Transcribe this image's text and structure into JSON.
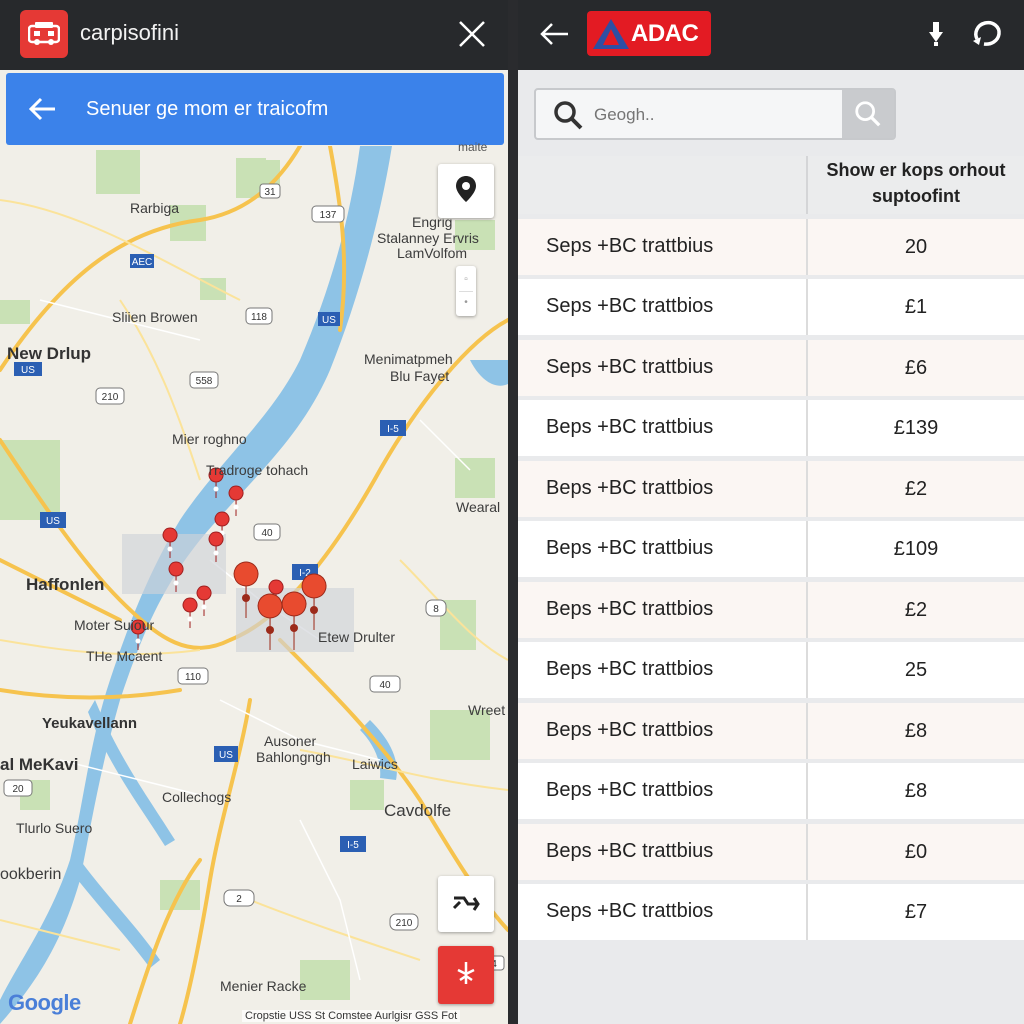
{
  "left_panel": {
    "app_title": "carpisofini",
    "route_bar": {
      "text": "Senuer ge mom er traicofm",
      "corner_text": "maite"
    },
    "map": {
      "labels": [
        {
          "name": "Rarbiga",
          "text": "Rarbiga"
        },
        {
          "name": "Engrig",
          "text": "Engrig"
        },
        {
          "name": "Stalanney Ervris",
          "text": "Stalanney Ervris"
        },
        {
          "name": "LamVolfom",
          "text": "LamVolfom"
        },
        {
          "name": "Sliien Browen",
          "text": "Sliien Browen"
        },
        {
          "name": "New Drlup",
          "text": "New Drlup"
        },
        {
          "name": "Menimatpmeh",
          "text": "Menimatpmeh"
        },
        {
          "name": "Blu Fayet",
          "text": "Blu Fayet"
        },
        {
          "name": "Mier roghno",
          "text": "Mier roghno"
        },
        {
          "name": "Tradroge tohach",
          "text": "Tradroge tohach"
        },
        {
          "name": "Wearal",
          "text": "Wearal"
        },
        {
          "name": "Haffonlen",
          "text": "Haffonlen"
        },
        {
          "name": "Moter Suiour",
          "text": "Moter Suiour"
        },
        {
          "name": "THe Mcaent",
          "text": "THe Mcaent"
        },
        {
          "name": "Etew Drulter",
          "text": "Etew Drulter"
        },
        {
          "name": "Wreet",
          "text": "Wreet"
        },
        {
          "name": "Yeukavellann",
          "text": "Yeukavellann"
        },
        {
          "name": "Ausoner",
          "text": "Ausoner"
        },
        {
          "name": "Bahlongngh",
          "text": "Bahlongngh"
        },
        {
          "name": "al MeKavi",
          "text": "al MeKavi"
        },
        {
          "name": "Laiwics",
          "text": "Laiwics"
        },
        {
          "name": "Collechogs",
          "text": "Collechogs"
        },
        {
          "name": "Cavdolfe",
          "text": "Cavdolfe"
        },
        {
          "name": "Tlurlo Suero",
          "text": "Tlurlo Suero"
        },
        {
          "name": "ookberin",
          "text": "ookberin"
        },
        {
          "name": "Menier Racke",
          "text": "Menier Racke"
        }
      ],
      "google_logo": "Google",
      "attribution": "Cropstie  USS St Comstee Aurlgisr  GSS Fot"
    }
  },
  "right_panel": {
    "brand": "ADAC",
    "search": {
      "placeholder": "Geogh.."
    },
    "table": {
      "header_col2": "Show er kops orhout suptoofint",
      "rows": [
        {
          "label": "Seps +BC trattbius",
          "value": "20"
        },
        {
          "label": "Seps +BC trattbios",
          "value": "£1"
        },
        {
          "label": "Seps +BC trattbius",
          "value": "£6"
        },
        {
          "label": "Beps +BC trattbius",
          "value": "£139"
        },
        {
          "label": "Beps +BC trattbios",
          "value": "£2"
        },
        {
          "label": "Beps +BC trattbius",
          "value": "£109"
        },
        {
          "label": "Beps +BC trattbios",
          "value": "£2"
        },
        {
          "label": "Beps +BC trattbios",
          "value": "25"
        },
        {
          "label": "Beps +BC trattbios",
          "value": "£8"
        },
        {
          "label": "Beps +BC trattbios",
          "value": "£8"
        },
        {
          "label": "Beps +BC trattbius",
          "value": "£0"
        },
        {
          "label": "Seps +BC trattbios",
          "value": "£7"
        }
      ]
    }
  },
  "colors": {
    "topbar": "#27292c",
    "route_bar": "#3b82ea",
    "accent_red": "#e53935",
    "adac_red": "#e31b23",
    "river": "#8ec3e6",
    "road": "#f6c34e"
  },
  "icons": [
    "app-logo-icon",
    "close-icon",
    "back-arrow-icon",
    "location-pin-icon",
    "zoom-icon",
    "route-icon",
    "navigation-icon",
    "search-icon",
    "download-icon",
    "refresh-icon"
  ]
}
